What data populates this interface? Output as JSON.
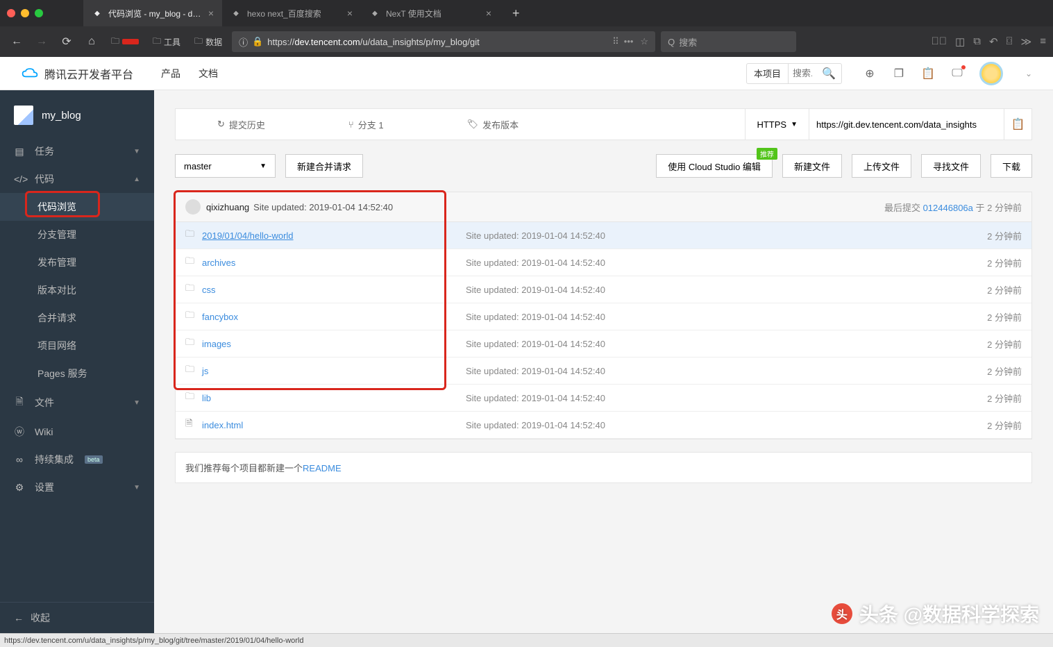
{
  "browser": {
    "tabs": [
      {
        "title": "代码浏览 - my_blog - data_insi",
        "active": true
      },
      {
        "title": "hexo next_百度搜索",
        "active": false
      },
      {
        "title": "NexT 使用文档",
        "active": false
      }
    ],
    "bookmarks": [
      {
        "label": "工具"
      },
      {
        "label": "数据"
      }
    ],
    "url_prefix": "https://",
    "url_domain": "dev.tencent.com",
    "url_path": "/u/data_insights/p/my_blog/git",
    "search_placeholder": "搜索"
  },
  "app_header": {
    "brand": "腾讯云开发者平台",
    "nav": [
      "产品",
      "文档"
    ],
    "search_scope": "本项目",
    "search_placeholder": "搜索..."
  },
  "sidebar": {
    "project": "my_blog",
    "items": [
      {
        "icon": "tasks",
        "label": "任务",
        "expand": true
      },
      {
        "icon": "code",
        "label": "代码",
        "expand": true,
        "open": true
      }
    ],
    "code_subs": [
      "代码浏览",
      "分支管理",
      "发布管理",
      "版本对比",
      "合并请求",
      "项目网络",
      "Pages 服务"
    ],
    "active_sub": 0,
    "items2": [
      {
        "icon": "file",
        "label": "文件",
        "expand": true
      },
      {
        "icon": "wiki",
        "label": "Wiki"
      },
      {
        "icon": "ci",
        "label": "持续集成",
        "beta": "beta"
      },
      {
        "icon": "cog",
        "label": "设置",
        "expand": true
      }
    ],
    "collapse": "收起"
  },
  "repo_bar": {
    "tabs": [
      {
        "icon": "history",
        "label": "提交历史"
      },
      {
        "icon": "branch",
        "label": "分支 1"
      },
      {
        "icon": "tag",
        "label": "发布版本"
      }
    ],
    "protocol": "HTTPS",
    "clone_url": "https://git.dev.tencent.com/data_insights"
  },
  "actions": {
    "branch": "master",
    "new_mr": "新建合并请求",
    "cloud_studio": "使用 Cloud Studio 编辑",
    "cloud_badge": "推荐",
    "new_file": "新建文件",
    "upload": "上传文件",
    "find": "寻找文件",
    "download": "下载"
  },
  "commit": {
    "author": "qixizhuang",
    "msg": "Site updated: 2019-01-04 14:52:40",
    "last_commit_label": "最后提交",
    "sha": "012446806a",
    "time_prefix": "于",
    "time": "2 分钟前"
  },
  "files": [
    {
      "type": "folder",
      "name": "2019/01/04/hello-world",
      "msg": "Site updated: 2019-01-04 14:52:40",
      "time": "2 分钟前",
      "hovered": true
    },
    {
      "type": "folder",
      "name": "archives",
      "msg": "Site updated: 2019-01-04 14:52:40",
      "time": "2 分钟前"
    },
    {
      "type": "folder",
      "name": "css",
      "msg": "Site updated: 2019-01-04 14:52:40",
      "time": "2 分钟前"
    },
    {
      "type": "folder",
      "name": "fancybox",
      "msg": "Site updated: 2019-01-04 14:52:40",
      "time": "2 分钟前"
    },
    {
      "type": "folder",
      "name": "images",
      "msg": "Site updated: 2019-01-04 14:52:40",
      "time": "2 分钟前"
    },
    {
      "type": "folder",
      "name": "js",
      "msg": "Site updated: 2019-01-04 14:52:40",
      "time": "2 分钟前"
    },
    {
      "type": "folder",
      "name": "lib",
      "msg": "Site updated: 2019-01-04 14:52:40",
      "time": "2 分钟前"
    },
    {
      "type": "file",
      "name": "index.html",
      "msg": "Site updated: 2019-01-04 14:52:40",
      "time": "2 分钟前"
    }
  ],
  "readme": {
    "prefix": "我们推荐每个项目都新建一个",
    "link": "README"
  },
  "status_bar": "https://dev.tencent.com/u/data_insights/p/my_blog/git/tree/master/2019/01/04/hello-world",
  "watermark": "头条 @数据科学探索"
}
